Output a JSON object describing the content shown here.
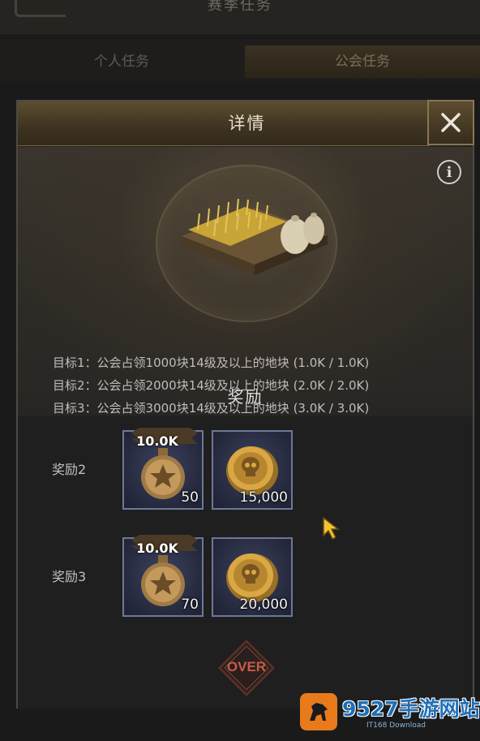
{
  "background": {
    "title": "赛季任务",
    "tabs": [
      "个人任务",
      "公会任务"
    ]
  },
  "dialog": {
    "title": "详情",
    "close_icon": "close-icon",
    "info_icon": "info-icon",
    "goals": [
      "目标1：公会占领1000块14级及以上的地块 (1.0K / 1.0K)",
      "目标2：公会占领2000块14级及以上的地块 (2.0K / 2.0K)",
      "目标3：公会占领3000块14级及以上的地块 (3.0K / 3.0K)"
    ],
    "reward_title": "奖励",
    "rewards": [
      {
        "label": "奖励2",
        "items": [
          {
            "icon": "medal-star-icon",
            "badge": "10.0K",
            "qty": "50"
          },
          {
            "icon": "skull-coin-icon",
            "qty": "15,000"
          }
        ]
      },
      {
        "label": "奖励3",
        "items": [
          {
            "icon": "medal-star-icon",
            "badge": "10.0K",
            "qty": "70"
          },
          {
            "icon": "skull-coin-icon",
            "qty": "20,000"
          }
        ]
      }
    ],
    "status_stamp": "OVER"
  },
  "watermark": {
    "text": "9527手游网站",
    "sub": "IT168 Download"
  },
  "colors": {
    "header_gold": "#5d4c2f",
    "item_border": "#6e7896",
    "over_red": "#c85a4a"
  }
}
